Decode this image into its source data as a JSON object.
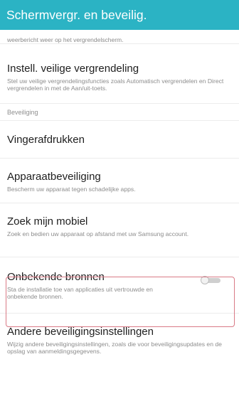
{
  "header": {
    "title": "Schermvergr. en beveilig."
  },
  "top_partial": {
    "desc": "weerbericht weer op het vergrendelscherm."
  },
  "items": [
    {
      "title": "Instell. veilige vergrendeling",
      "desc": "Stel uw veilige vergrendelingsfuncties zoals Automatisch vergrendelen en Direct vergrendelen in met de Aan/uit-toets."
    }
  ],
  "section": {
    "label": "Beveiliging"
  },
  "security_items": [
    {
      "title": "Vingerafdrukken",
      "desc": ""
    },
    {
      "title": "Apparaatbeveiliging",
      "desc": "Bescherm uw apparaat tegen schadelijke apps."
    },
    {
      "title": "Zoek mijn mobiel",
      "desc": "Zoek en bedien uw apparaat op afstand met uw Samsung account."
    },
    {
      "title": "Onbekende bronnen",
      "desc": "Sta de installatie toe van applicaties uit vertrouwde en onbekende bronnen.",
      "toggle": "off"
    },
    {
      "title": "Andere beveiligingsinstellingen",
      "desc": "Wijzig andere beveiligingsinstellingen, zoals die voor beveiligingsupdates en de opslag van aanmeldingsgegevens."
    }
  ],
  "colors": {
    "appbar": "#2bb3c4",
    "highlight": "#d97a86"
  }
}
